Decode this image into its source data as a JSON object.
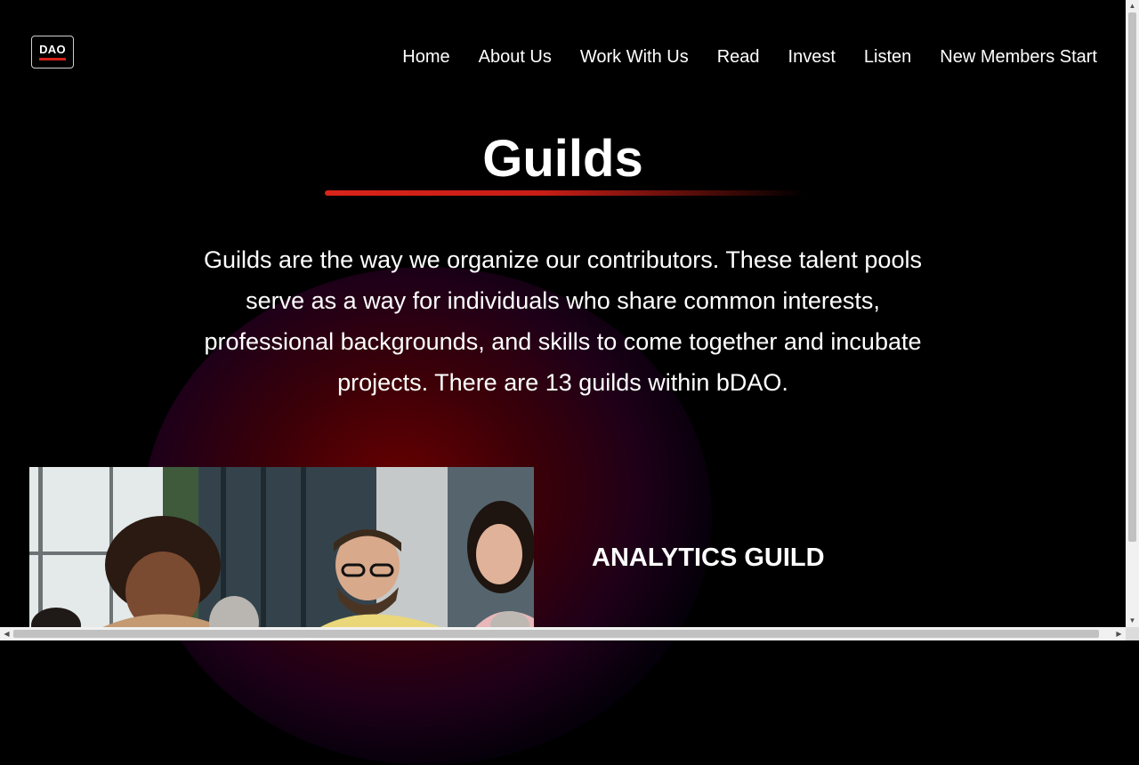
{
  "header": {
    "logo_text": "DAO",
    "logo_accent": "#d62318",
    "nav": [
      {
        "label": "Home"
      },
      {
        "label": "About Us"
      },
      {
        "label": "Work With Us"
      },
      {
        "label": "Read"
      },
      {
        "label": "Invest"
      },
      {
        "label": "Listen"
      },
      {
        "label": "New Members Start"
      }
    ]
  },
  "hero": {
    "title": "Guilds",
    "intro": "Guilds are the way we organize our contributors. These talent pools serve as a way for individuals who share common interests, professional backgrounds, and skills to come together and incubate projects. There are 13 guilds within bDAO.",
    "accent_color": "#d9241a"
  },
  "guilds": [
    {
      "title": "ANALYTICS GUILD",
      "image": "team-meeting-photo"
    }
  ],
  "scrollbars": {
    "up_icon": "▲",
    "down_icon": "▼",
    "left_icon": "◀",
    "right_icon": "▶"
  }
}
